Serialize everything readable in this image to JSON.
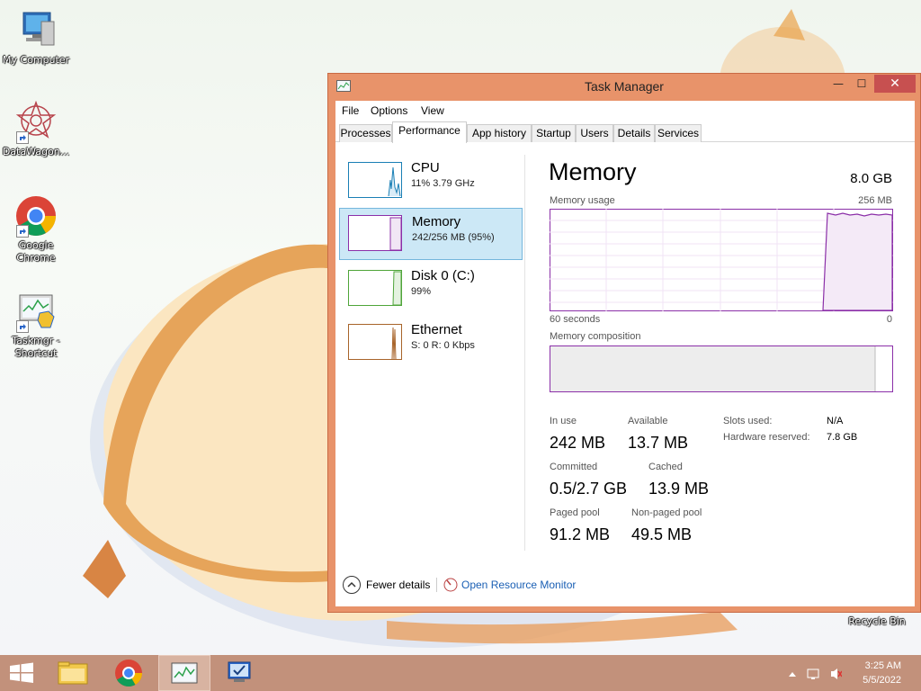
{
  "desktop": {
    "icons": [
      {
        "label": "My Computer"
      },
      {
        "label": "DataWagon..."
      },
      {
        "label": "Google Chrome"
      },
      {
        "label": "Taskmgr - Shortcut"
      },
      {
        "label": "Recycle Bin"
      }
    ]
  },
  "window": {
    "title": "Task Manager",
    "minimize": "—",
    "maximize": "☐",
    "close": "✕",
    "menu": [
      "File",
      "Options",
      "View"
    ],
    "tabs": [
      "Processes",
      "Performance",
      "App history",
      "Startup",
      "Users",
      "Details",
      "Services"
    ],
    "active_tab": "Performance"
  },
  "sidebar": {
    "items": [
      {
        "name": "CPU",
        "sub": "11%  3.79 GHz",
        "color": "#1a7fb5"
      },
      {
        "name": "Memory",
        "sub": "242/256 MB (95%)",
        "color": "#8b2fa8"
      },
      {
        "name": "Disk 0 (C:)",
        "sub": "99%",
        "color": "#4fa53a"
      },
      {
        "name": "Ethernet",
        "sub": "S: 0  R: 0 Kbps",
        "color": "#a8642a"
      }
    ],
    "selected": "Memory"
  },
  "memory": {
    "title": "Memory",
    "total": "8.0 GB",
    "usage_label": "Memory usage",
    "usage_max": "256 MB",
    "graph_left": "60 seconds",
    "graph_right": "0",
    "composition_label": "Memory composition",
    "in_use_label": "In use",
    "in_use": "242 MB",
    "available_label": "Available",
    "available": "13.7 MB",
    "committed_label": "Committed",
    "committed": "0.5/2.7 GB",
    "cached_label": "Cached",
    "cached": "13.9 MB",
    "paged_label": "Paged pool",
    "paged": "91.2 MB",
    "nonpaged_label": "Non-paged pool",
    "nonpaged": "49.5 MB",
    "slots_label": "Slots used:",
    "slots": "N/A",
    "hw_label": "Hardware reserved:",
    "hw": "7.8 GB",
    "graph_color": "#8b2fa8"
  },
  "footer": {
    "fewer": "Fewer details",
    "resmon": "Open Resource Monitor"
  },
  "taskbar": {
    "time": "3:25 AM",
    "date": "5/5/2022"
  }
}
